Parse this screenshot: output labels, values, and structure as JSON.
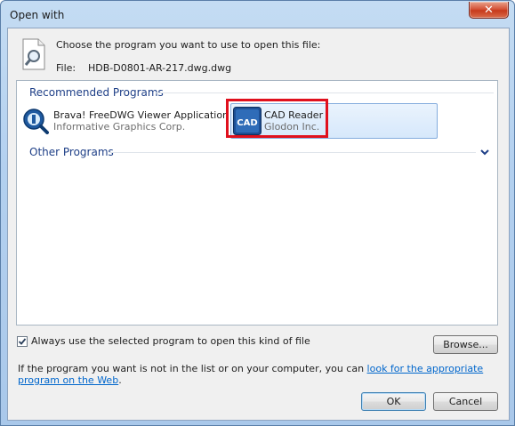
{
  "window": {
    "title": "Open with",
    "close_glyph": "✕"
  },
  "header": {
    "prompt": "Choose the program you want to use to open this file:",
    "file_label": "File:",
    "file_name": "HDB-D0801-AR-217.dwg.dwg"
  },
  "groups": {
    "recommended": "Recommended Programs",
    "other": "Other Programs"
  },
  "programs": [
    {
      "name": "Brava! FreeDWG Viewer Application",
      "publisher": "Informative Graphics Corp.",
      "icon": "magnifier-icon"
    },
    {
      "name": "CAD Reader",
      "publisher": "Glodon Inc.",
      "icon": "cad-reader-icon",
      "icon_text": "CAD",
      "selected": true
    }
  ],
  "footer": {
    "always_use_label": "Always use the selected program to open this kind of file",
    "always_use_checked": true,
    "browse_label": "Browse...",
    "info_prefix": "If the program you want is not in the list or on your computer, you can ",
    "info_link": "look for the appropriate program on the Web",
    "info_suffix": ".",
    "ok_label": "OK",
    "cancel_label": "Cancel"
  },
  "colors": {
    "group_header": "#1e3f87",
    "link": "#0066cc",
    "highlight_border": "#e0101d"
  }
}
